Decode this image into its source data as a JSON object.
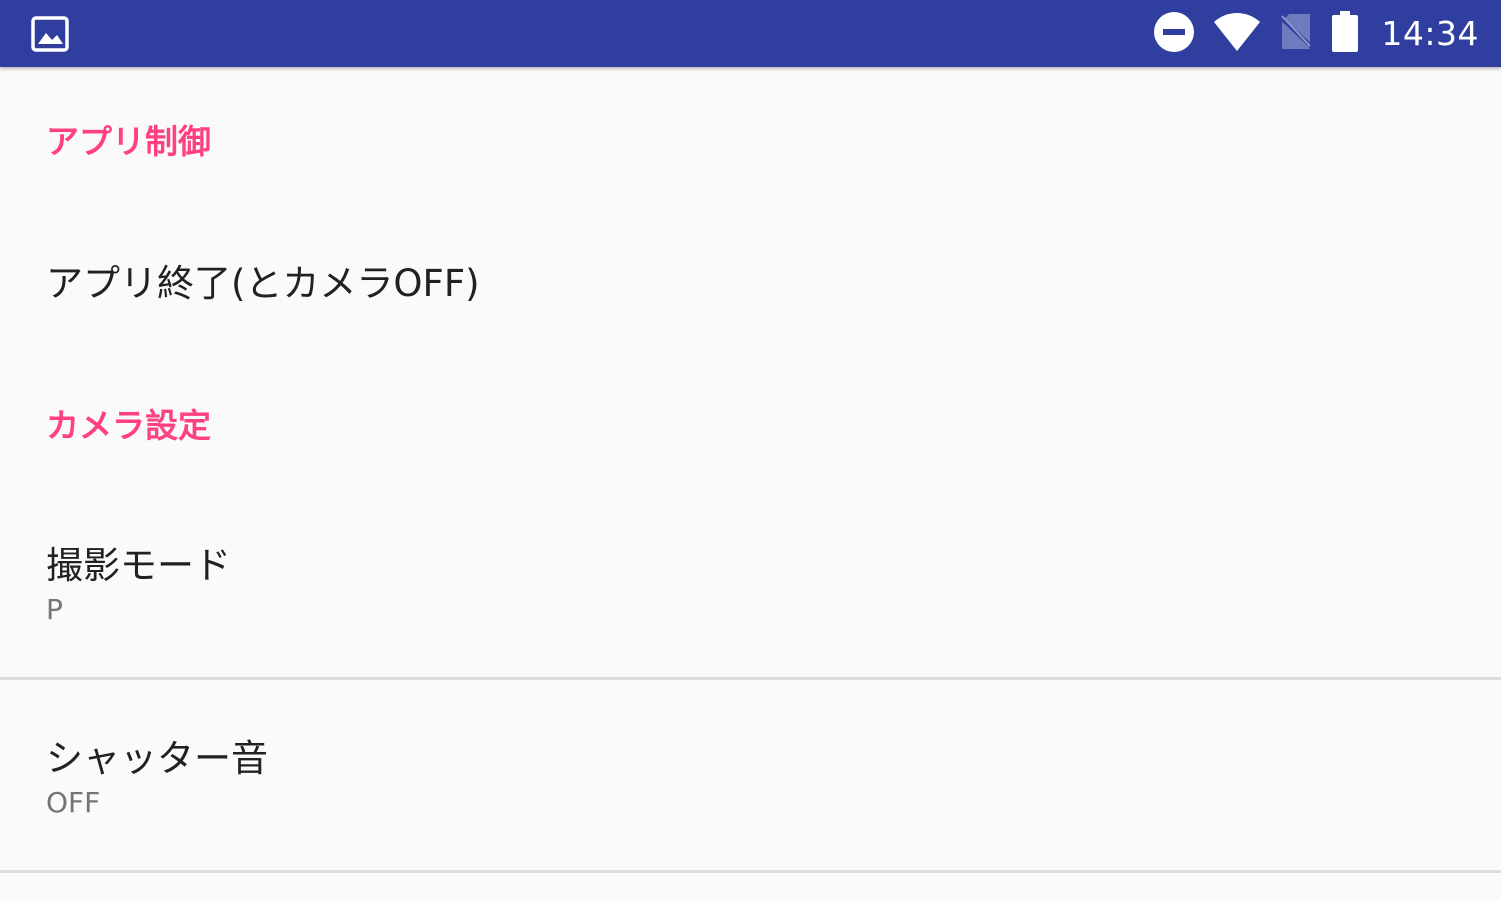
{
  "status_bar": {
    "time": "14:34",
    "background_color": "#303f9f",
    "left_icon": "image-icon",
    "right_icons": [
      "do-not-disturb-icon",
      "wifi-icon",
      "no-sim-icon",
      "battery-icon"
    ]
  },
  "sections": [
    {
      "category": "アプリ制御",
      "items": [
        {
          "title": "アプリ終了(とカメラOFF)"
        }
      ]
    },
    {
      "category": "カメラ設定",
      "items": [
        {
          "title": "撮影モード",
          "summary": "P"
        },
        {
          "title": "シャッター音",
          "summary": "OFF"
        }
      ]
    }
  ],
  "colors": {
    "accent": "#ff4081",
    "title_text": "#212121",
    "summary_text": "#757575",
    "background": "#fafafa",
    "divider": "#dcdcdc"
  }
}
